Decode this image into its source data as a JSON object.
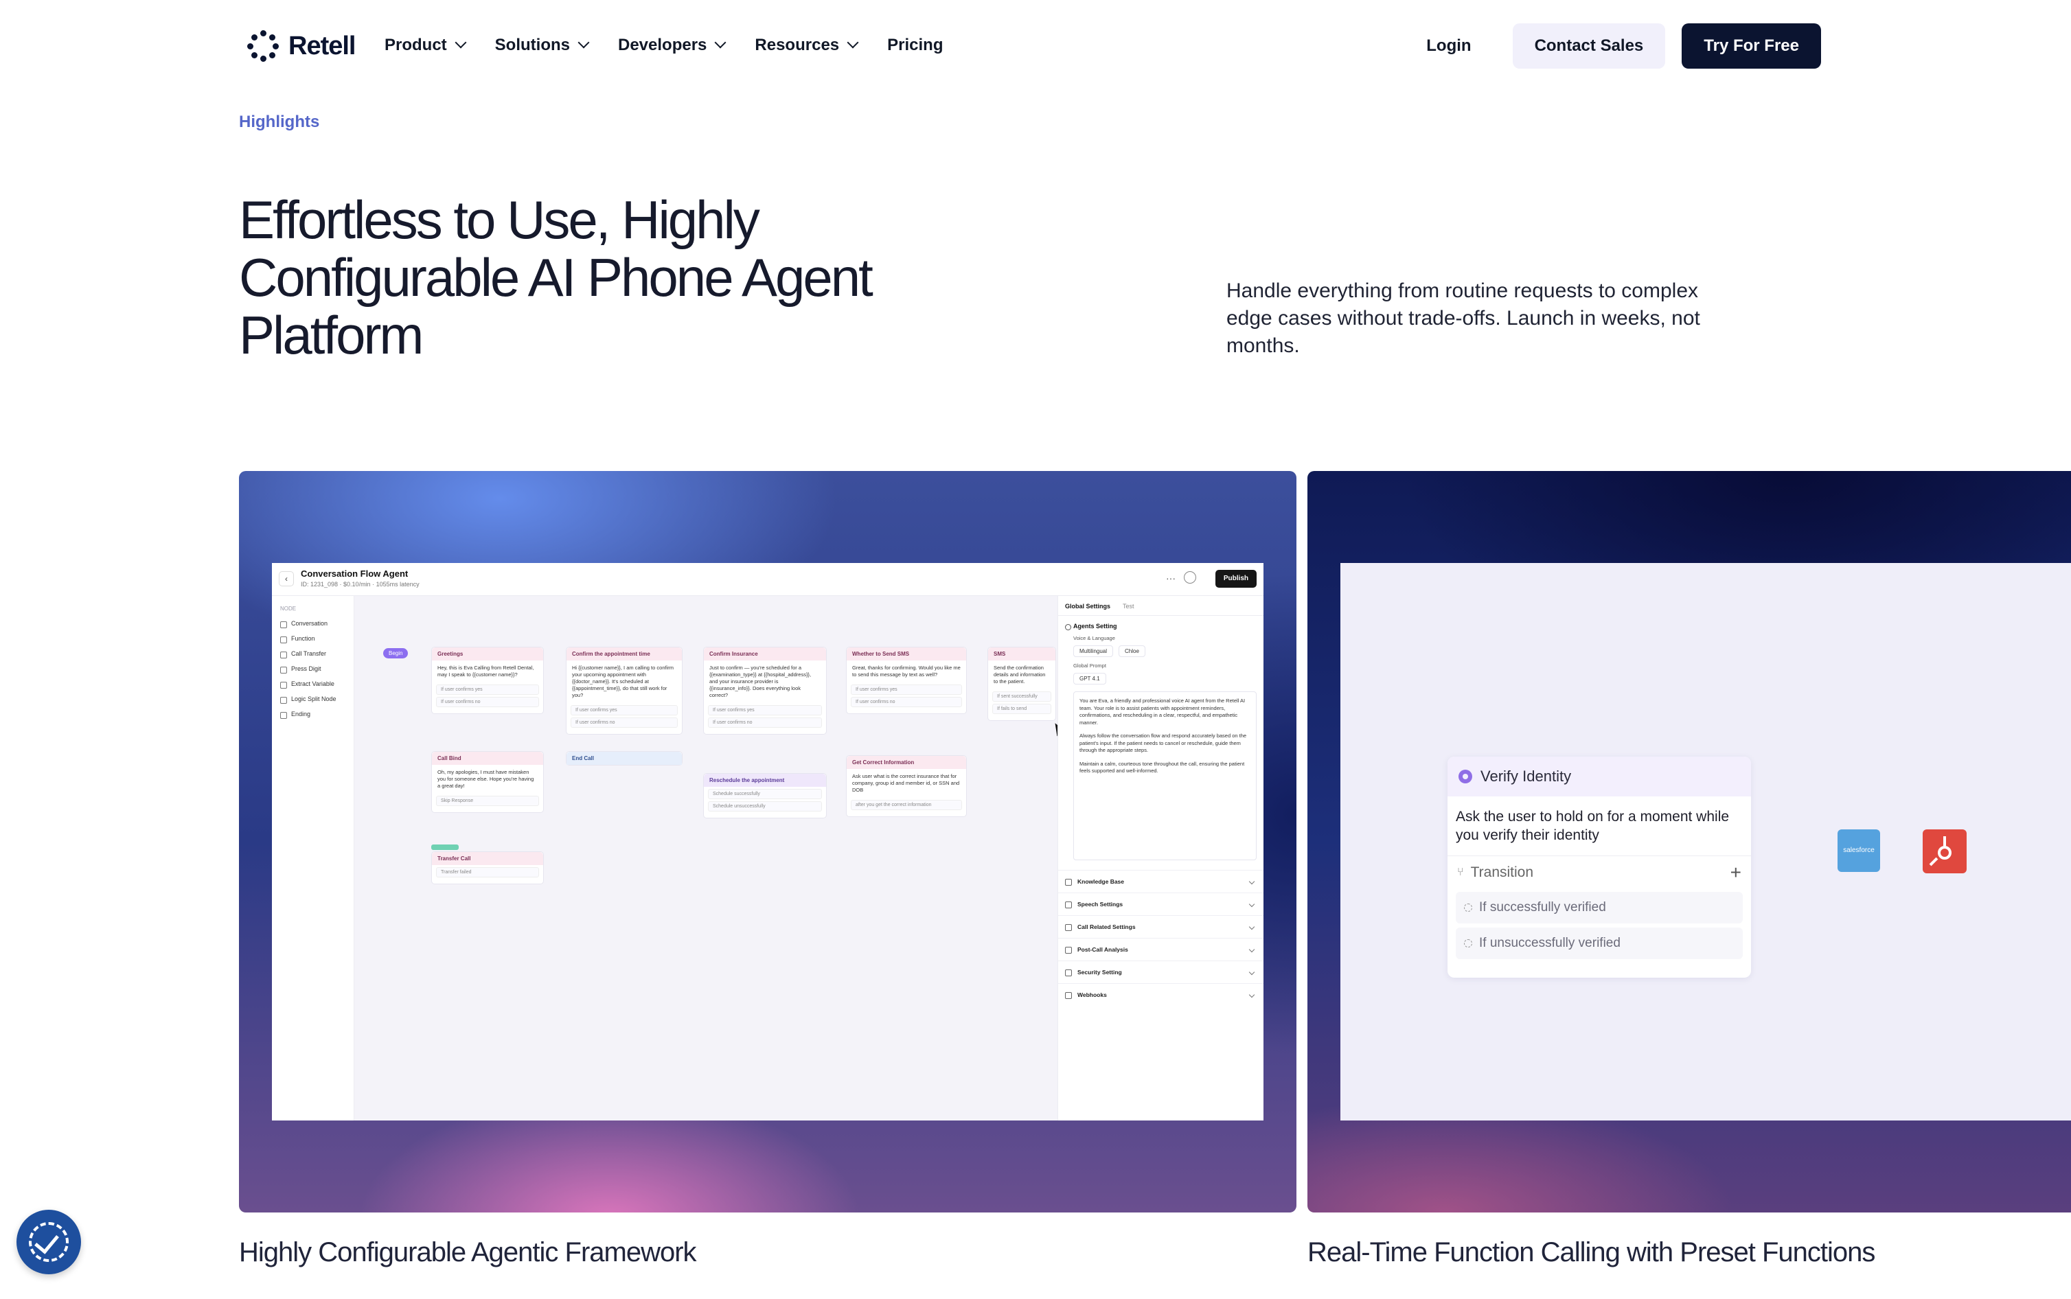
{
  "brand": {
    "name": "Retell"
  },
  "nav": {
    "items": [
      {
        "label": "Product",
        "has_menu": true
      },
      {
        "label": "Solutions",
        "has_menu": true
      },
      {
        "label": "Developers",
        "has_menu": true
      },
      {
        "label": "Resources",
        "has_menu": true
      },
      {
        "label": "Pricing",
        "has_menu": false
      }
    ],
    "login": "Login",
    "contact": "Contact Sales",
    "try": "Try For Free"
  },
  "hero": {
    "eyebrow": "Highlights",
    "headline": "Effortless to Use, Highly Configurable AI Phone Agent Platform",
    "lead": "Handle everything from routine requests to complex edge cases without trade-offs. Launch in weeks, not months."
  },
  "cards": [
    {
      "caption": "Highly Configurable Agentic Framework"
    },
    {
      "caption": "Real-Time Function Calling with Preset Functions"
    }
  ],
  "app": {
    "title": "Conversation Flow Agent",
    "meta": "ID: 1231_098 · $0.10/min · 1055ms latency",
    "publish": "Publish",
    "sidebar": {
      "heading": "NODE",
      "items": [
        "Conversation",
        "Function",
        "Call Transfer",
        "Press Digit",
        "Extract Variable",
        "Logic Split Node",
        "Ending"
      ]
    },
    "begin": "Begin",
    "nodes": [
      {
        "title": "Greetings",
        "body": "Hey, this is Eva Calling from Retell Dental, may I speak to {{customer name}}?",
        "options": [
          "If user confirms yes",
          "If user confirms no"
        ]
      },
      {
        "title": "Confirm the appointment time",
        "body": "Hi {{customer name}}, I am calling to confirm your upcoming appointment with {{doctor_name}}. It's scheduled at {{appointment_time}}, do that still work for you?",
        "options": [
          "If user confirms yes",
          "If user confirms no"
        ]
      },
      {
        "title": "Confirm Insurance",
        "body": "Just to confirm — you're scheduled for a {{examination_type}} at {{hospital_address}}, and your insurance provider is {{insurance_info}}. Does everything look correct?",
        "options": [
          "If user confirms yes",
          "If user confirms no"
        ]
      },
      {
        "title": "Whether to Send SMS",
        "body": "Great, thanks for confirming. Would you like me to send this message by text as well?",
        "options": [
          "If user confirms yes",
          "If user confirms no"
        ]
      },
      {
        "title": "SMS",
        "body": "Send the confirmation details and information to the patient.",
        "options": [
          "If sent successfully",
          "If fails to send"
        ]
      },
      {
        "title": "Call Bind",
        "body": "Oh, my apologies, I must have mistaken you for someone else. Hope you're having a great day!",
        "options": [
          "Skip Response"
        ]
      },
      {
        "title": "End Call",
        "body": "",
        "options": []
      },
      {
        "title": "Reschedule the appointment",
        "body": "",
        "options": [
          "Schedule successfully",
          "Schedule unsuccessfully"
        ]
      },
      {
        "title": "Get Correct Information",
        "body": "Ask user what is the correct insurance that for company, group id and member id, or SSN and DOB",
        "options": [
          "after you get the correct information"
        ]
      },
      {
        "title": "Transfer Call",
        "body": "",
        "options": [
          "Transfer failed"
        ]
      }
    ],
    "panel": {
      "tabs": [
        "Global Settings",
        "Test"
      ],
      "agents_setting": "Agents Setting",
      "voice_label": "Voice & Language",
      "language": "Multilingual",
      "voice": "Chloe",
      "prompt_label": "Global Prompt",
      "model": "GPT 4.1",
      "prompt": [
        "You are Eva, a friendly and professional voice AI agent from the Retell AI team. Your role is to assist patients with appointment reminders, confirmations, and rescheduling in a clear, respectful, and empathetic manner.",
        "Always follow the conversation flow and respond accurately based on the patient's input. If the patient needs to cancel or reschedule, guide them through the appropriate steps.",
        "Maintain a calm, courteous tone throughout the call, ensuring the patient feels supported and well-informed."
      ],
      "sections": [
        "Knowledge Base",
        "Speech Settings",
        "Call Related Settings",
        "Post-Call Analysis",
        "Security Setting",
        "Webhooks"
      ]
    }
  },
  "verify_card": {
    "title": "Verify Identity",
    "body": "Ask the user to hold on for a moment while you verify their identity",
    "transition": "Transition",
    "options": [
      "If successfully verified",
      "If unsuccessfully verified"
    ],
    "integration_label": "salesforce"
  },
  "icons": {
    "chevron": "chevron-down-icon",
    "accessibility": "accessibility-icon"
  },
  "colors": {
    "brand_dark": "#0b1430",
    "accent": "#5567c9",
    "contact_bg": "#f1f0fb"
  }
}
